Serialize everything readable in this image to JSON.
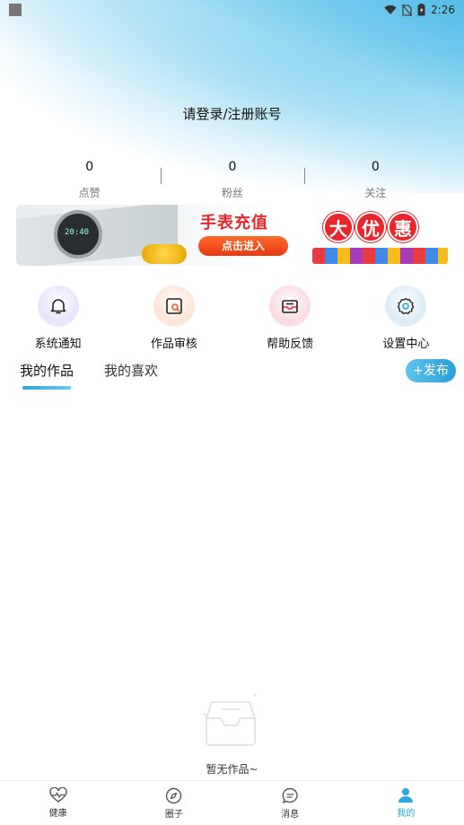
{
  "status_bar": {
    "time": "2:26"
  },
  "header": {
    "login_prompt": "请登录/注册账号"
  },
  "stats": [
    {
      "value": "0",
      "label": "点赞"
    },
    {
      "value": "0",
      "label": "粉丝"
    },
    {
      "value": "0",
      "label": "关注"
    }
  ],
  "banner": {
    "watch_time": "20:40",
    "title": "手表充值",
    "button": "点击进入",
    "promo": [
      "大",
      "优",
      "惠"
    ]
  },
  "actions": [
    {
      "label": "系统通知",
      "icon": "bell-icon"
    },
    {
      "label": "作品审核",
      "icon": "review-icon"
    },
    {
      "label": "帮助反馈",
      "icon": "mail-icon"
    },
    {
      "label": "设置中心",
      "icon": "gear-icon"
    }
  ],
  "tabs": [
    {
      "label": "我的作品",
      "active": true
    },
    {
      "label": "我的喜欢",
      "active": false
    }
  ],
  "publish_button": "+发布",
  "empty_state": {
    "text": "暂无作品~",
    "icon": "empty-box-icon"
  },
  "bottom_nav": [
    {
      "label": "健康",
      "icon": "heart-pulse-icon",
      "active": false
    },
    {
      "label": "圈子",
      "icon": "compass-icon",
      "active": false
    },
    {
      "label": "消息",
      "icon": "chat-icon",
      "active": false
    },
    {
      "label": "我的",
      "icon": "person-icon",
      "active": true
    }
  ],
  "colors": {
    "accent": "#2aa7df",
    "banner_red": "#e8262b"
  }
}
